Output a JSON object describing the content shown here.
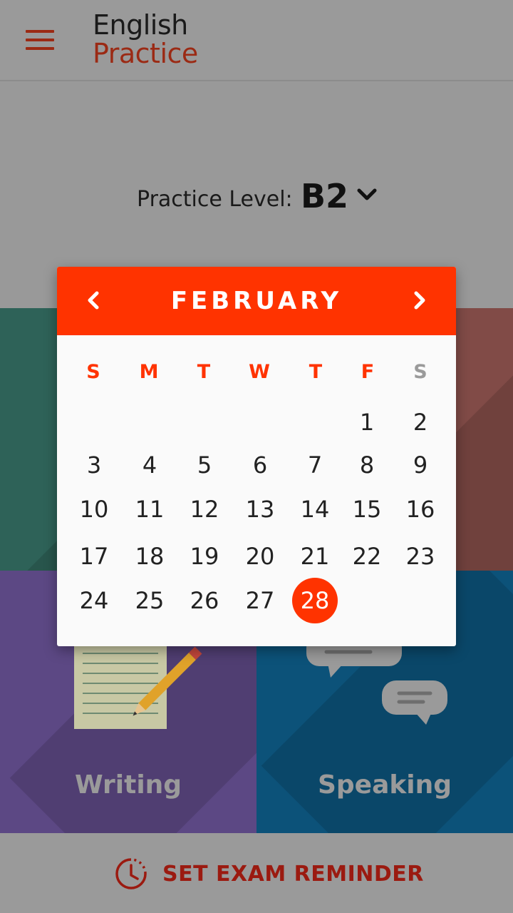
{
  "app": {
    "title_line1": "English",
    "title_line2": "Practice"
  },
  "level": {
    "label": "Practice Level:",
    "value": "B2"
  },
  "tiles": {
    "writing": "Writing",
    "speaking": "Speaking"
  },
  "calendar": {
    "month": "FEBRUARY",
    "weekdays": [
      "S",
      "M",
      "T",
      "W",
      "T",
      "F",
      "S"
    ],
    "days": [
      "1",
      "2",
      "3",
      "4",
      "5",
      "6",
      "7",
      "8",
      "9",
      "10",
      "11",
      "12",
      "13",
      "14",
      "15",
      "16",
      "17",
      "18",
      "19",
      "20",
      "21",
      "22",
      "23",
      "24",
      "25",
      "26",
      "27",
      "28"
    ],
    "selected_day": "28"
  },
  "bottom": {
    "reminder_label": "SET EXAM REMINDER"
  },
  "colors": {
    "accent": "#ff3300",
    "brand": "#9b2a14"
  },
  "icons": [
    "menu-icon",
    "chevron-down-icon",
    "chevron-left-icon",
    "chevron-right-icon",
    "clock-icon",
    "notepad-pencil-icon",
    "speech-bubbles-icon"
  ]
}
